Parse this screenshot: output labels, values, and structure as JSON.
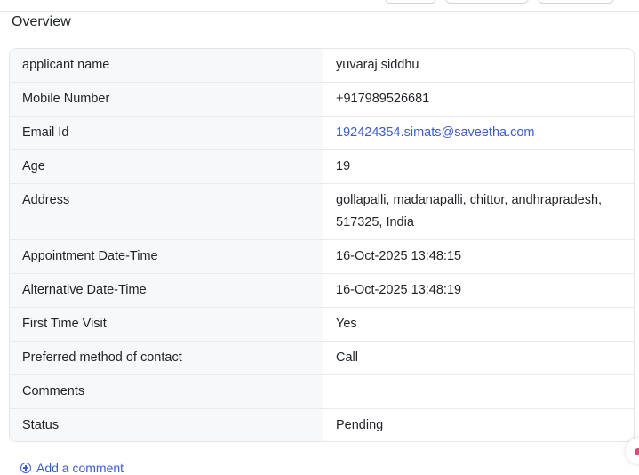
{
  "section": {
    "title": "Overview"
  },
  "rows": [
    {
      "label": "applicant name",
      "value": "yuvaraj siddhu",
      "link": false
    },
    {
      "label": "Mobile Number",
      "value": "+917989526681",
      "link": false
    },
    {
      "label": "Email Id",
      "value": "192424354.simats@saveetha.com",
      "link": true
    },
    {
      "label": "Age",
      "value": "19",
      "link": false
    },
    {
      "label": "Address",
      "value": "gollapalli, madanapalli, chittor, andhrapradesh, 517325, India",
      "link": false
    },
    {
      "label": "Appointment Date-Time",
      "value": "16-Oct-2025 13:48:15",
      "link": false
    },
    {
      "label": "Alternative Date-Time",
      "value": "16-Oct-2025 13:48:19",
      "link": false
    },
    {
      "label": "First Time Visit",
      "value": "Yes",
      "link": false
    },
    {
      "label": "Preferred method of contact",
      "value": "Call",
      "link": false
    },
    {
      "label": "Comments",
      "value": "",
      "link": false
    },
    {
      "label": "Status",
      "value": "Pending",
      "link": false
    }
  ],
  "actions": {
    "add_comment": "Add a comment"
  },
  "colors": {
    "link": "#3b5bd6",
    "label_bg": "#f7f8fa",
    "border": "#e8eaed",
    "chat_dot": "#e0457b"
  }
}
